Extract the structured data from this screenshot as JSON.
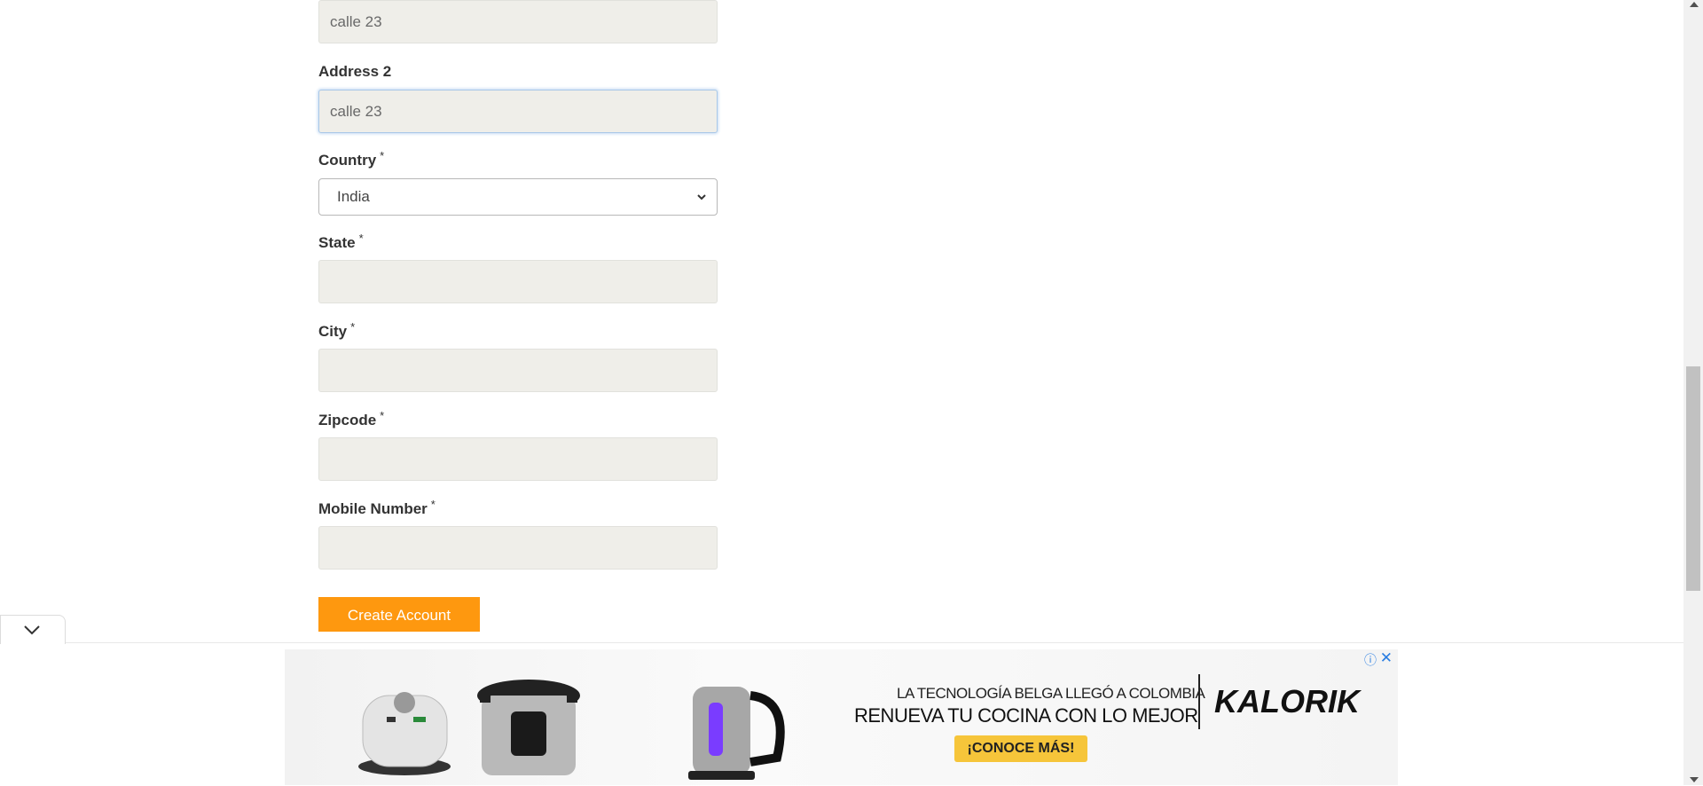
{
  "form": {
    "address1_value": "calle 23",
    "address2_label": "Address 2",
    "address2_value": "calle 23",
    "country_label": "Country",
    "country_selected": "India",
    "state_label": "State",
    "state_value": "",
    "city_label": "City",
    "city_value": "",
    "zipcode_label": "Zipcode",
    "zipcode_value": "",
    "mobile_label": "Mobile Number",
    "mobile_value": "",
    "required_mark": "*",
    "submit_label": "Create Account"
  },
  "ad": {
    "tagline": "LA TECNOLOGÍA BELGA LLEGÓ A COLOMBIA",
    "headline": "RENUEVA TU COCINA CON LO MEJOR",
    "brand": "KALORIK",
    "cta": "¡CONOCE MÁS!",
    "info_icon": "ⓘ",
    "close_icon": "✕"
  },
  "colors": {
    "button": "#fe980f",
    "input_bg": "#efeee9",
    "ad_link": "#2a7de1",
    "cta_bg": "#f6c53a"
  },
  "icons": [
    "chevron-down-icon",
    "info-icon",
    "close-icon",
    "collapse-chevron-icon"
  ]
}
